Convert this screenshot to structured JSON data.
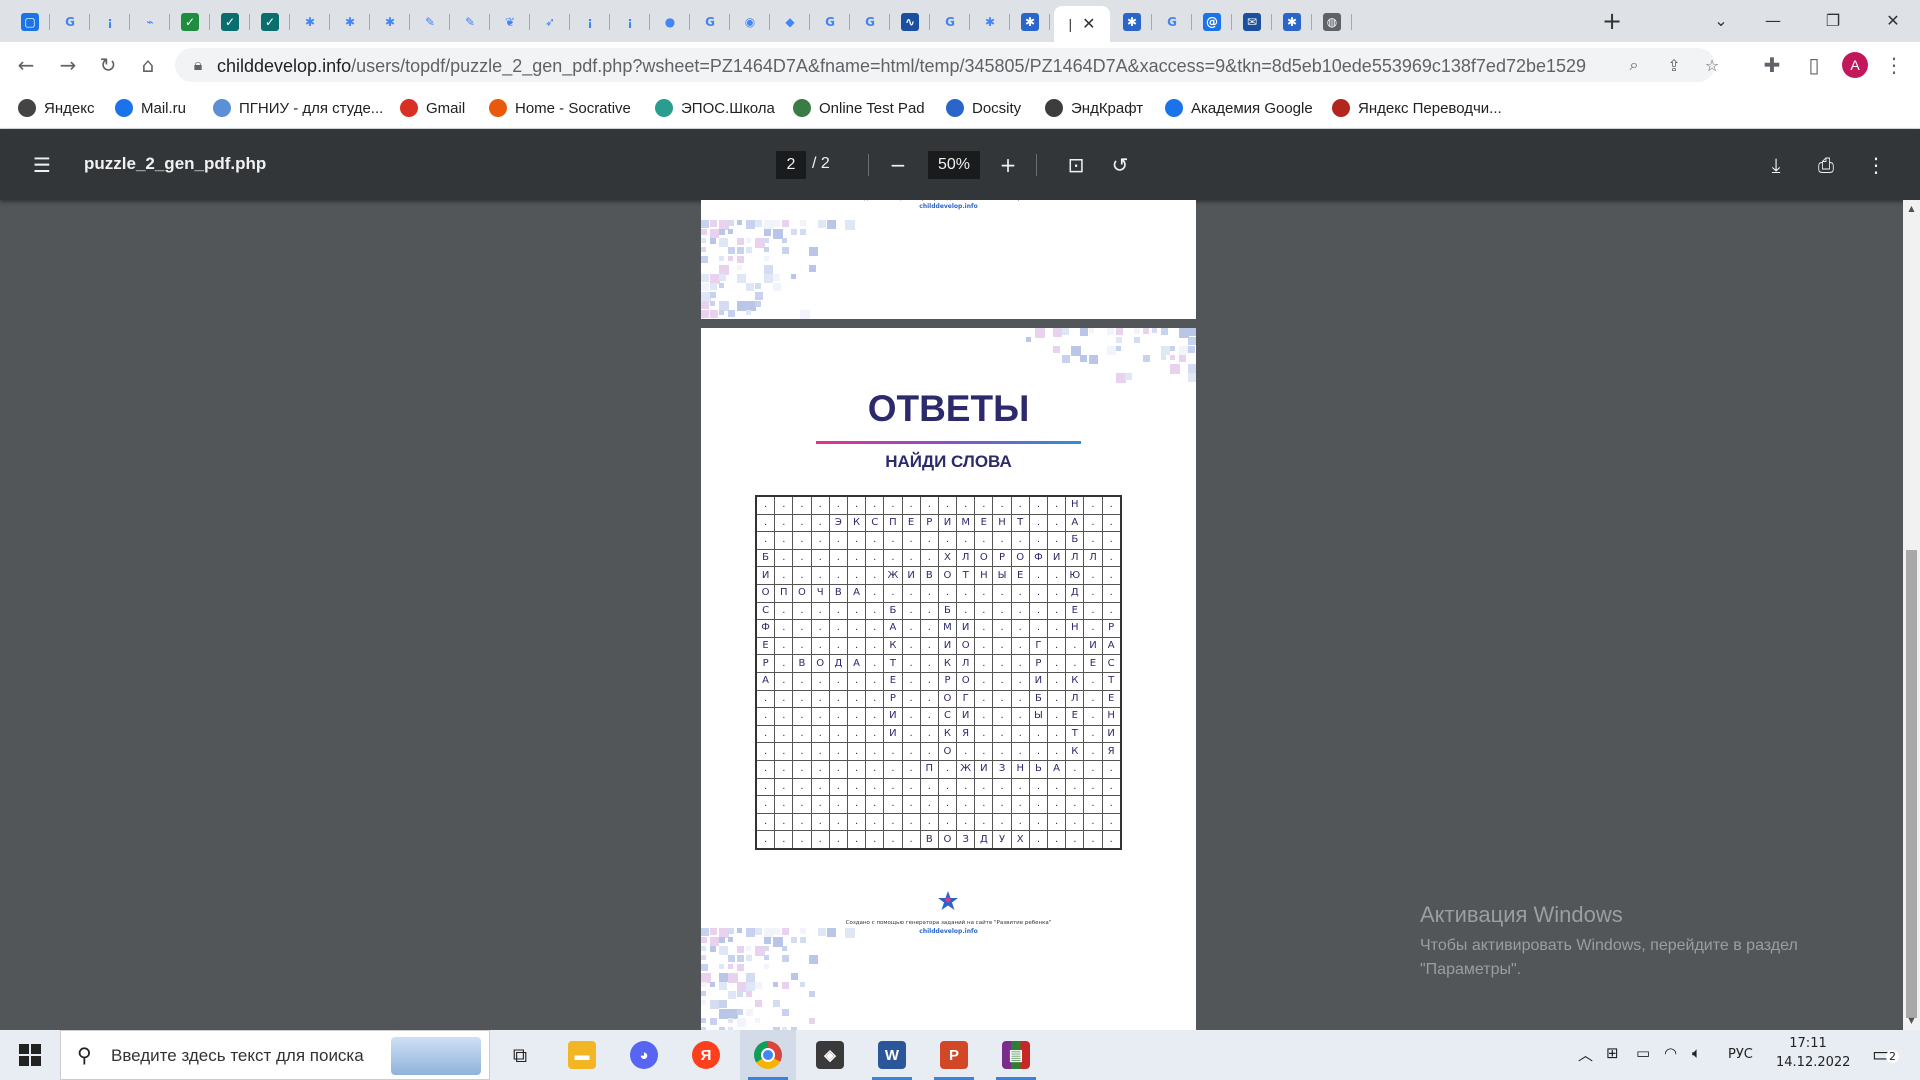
{
  "browser": {
    "tabs": [
      {
        "icon": "chat-icon",
        "color": "#1a73e8",
        "glyph": "▢"
      },
      {
        "icon": "google-icon",
        "color": "#fff",
        "glyph": "G"
      },
      {
        "icon": "yandex-icon",
        "color": "#fff",
        "glyph": "¡"
      },
      {
        "icon": "bird-icon",
        "color": "#fff",
        "glyph": "⌁"
      },
      {
        "icon": "check-green-icon",
        "color": "#1e8e3e",
        "glyph": "✓"
      },
      {
        "icon": "check-teal-icon",
        "color": "#0b6e6e",
        "glyph": "✓"
      },
      {
        "icon": "check-teal-icon",
        "color": "#0b6e6e",
        "glyph": "✓"
      },
      {
        "icon": "puzzle-star-icon",
        "color": "#fff",
        "glyph": "✱"
      },
      {
        "icon": "puzzle-star-icon",
        "color": "#fff",
        "glyph": "✱"
      },
      {
        "icon": "puzzle-star-icon",
        "color": "#fff",
        "glyph": "✱"
      },
      {
        "icon": "paper-icon",
        "color": "#fff",
        "glyph": "✎"
      },
      {
        "icon": "paper-icon",
        "color": "#fff",
        "glyph": "✎"
      },
      {
        "icon": "apple-icon",
        "color": "#fff",
        "glyph": "❦"
      },
      {
        "icon": "sender-icon",
        "color": "#fff",
        "glyph": "➶"
      },
      {
        "icon": "yandex-icon",
        "color": "#fff",
        "glyph": "¡"
      },
      {
        "icon": "yandex-icon",
        "color": "#fff",
        "glyph": "¡"
      },
      {
        "icon": "ladybug-icon",
        "color": "#fff",
        "glyph": "●"
      },
      {
        "icon": "google-icon",
        "color": "#fff",
        "glyph": "G"
      },
      {
        "icon": "compass-icon",
        "color": "#fff",
        "glyph": "◉"
      },
      {
        "icon": "shield-icon",
        "color": "#fff",
        "glyph": "◆"
      },
      {
        "icon": "google-icon",
        "color": "#fff",
        "glyph": "G"
      },
      {
        "icon": "google-icon",
        "color": "#fff",
        "glyph": "G"
      },
      {
        "icon": "chart-icon",
        "color": "#1a4fa0",
        "glyph": "∿"
      },
      {
        "icon": "google-icon",
        "color": "#fff",
        "glyph": "G"
      },
      {
        "icon": "puzzle-star-icon",
        "color": "#fff",
        "glyph": "✱"
      },
      {
        "icon": "puzzle-blue-icon",
        "color": "#2a66c9",
        "glyph": "✱"
      }
    ],
    "active_tab": {
      "label": "|",
      "close": "✕"
    },
    "tabs_after": [
      {
        "icon": "puzzle-blue-icon",
        "color": "#2a66c9",
        "glyph": "✱"
      },
      {
        "icon": "google-icon",
        "color": "#fff",
        "glyph": "G"
      },
      {
        "icon": "mail-at-icon",
        "color": "#1a73e8",
        "glyph": "@"
      },
      {
        "icon": "mail-blue-icon",
        "color": "#1a4fa0",
        "glyph": "✉"
      },
      {
        "icon": "puzzle-blue-icon",
        "color": "#2a66c9",
        "glyph": "✱"
      },
      {
        "icon": "globe-icon",
        "color": "#5f6368",
        "glyph": "◍"
      }
    ],
    "url_host": "childdevelop.info",
    "url_rest": "/users/topdf/puzzle_2_gen_pdf.php?wsheet=PZ1464D7A&fname=html/temp/345805/PZ1464D7A&xaccess=9&tkn=8d5eb10ede553969c138f7ed72be1529",
    "avatar_letter": "A",
    "bookmarks": [
      {
        "label": "Яндекс",
        "color": "#444"
      },
      {
        "label": "Mail.ru",
        "color": "#1a73e8"
      },
      {
        "label": "ПГНИУ - для студе...",
        "color": "#5b8fd6"
      },
      {
        "label": "Gmail",
        "color": "#d93025"
      },
      {
        "label": "Home - Socrative",
        "color": "#e8590c"
      },
      {
        "label": "ЭПОС.Школа",
        "color": "#2a9d8f"
      },
      {
        "label": "Online Test Pad",
        "color": "#3a7d44"
      },
      {
        "label": "Docsity",
        "color": "#2a66c9"
      },
      {
        "label": "ЭндКрафт",
        "color": "#3d3d3d"
      },
      {
        "label": "Академия Google",
        "color": "#1a73e8"
      },
      {
        "label": "Яндекс Переводчи...",
        "color": "#b3261e"
      }
    ]
  },
  "pdf": {
    "filename": "puzzle_2_gen_pdf.php",
    "current_page": "2",
    "total_pages": "/  2",
    "zoom": "50%"
  },
  "sheet": {
    "title": "ОТВЕТЫ",
    "subtitle": "НАЙДИ СЛОВА",
    "footer_small": "Создано с помощью генератора заданий на сайте \"Развитие ребенка\"",
    "footer_link": "childdevelop.info",
    "grid": [
      ". . . . . . . . . . . . . . . . . Н . .",
      ". . . . Э К С П Е Р И М Е Н Т . . А . .",
      ". . . . . . . . . . . . . . . . . Б . .",
      "Б . . . . . . . . . Х Л О Р О Ф И Л Л .",
      "И . . . . . . Ж И В О Т Н Ы Е . . Ю . .",
      "О П О Ч В А . . . . . . . . . . . Д . .",
      "С . . . . . . Б . . Б . . . . . . Е . .",
      "Ф . . . . . . А . . М И . . . . . Н . Р",
      "Е . . . . . . К . . И О . . . Г . . И А",
      "Р . В О Д А . Т . . К Л . . . Р . . Е С",
      "А . . . . . . Е . . Р О . . . И . К . Т",
      ". . . . . . . Р . . О Г . . . Б . Л . Е",
      ". . . . . . . И . . С И . . . Ы . Е . Н",
      ". . . . . . . И . . К Я . . . . . Т . И",
      ". . . . . . . . . . О . . . . . . К . Я",
      ". . . . . . . . . П . Ж И З Н Ь А . . .",
      ". . . . . . . . . . . . . . . . . . . .",
      ". . . . . . . . . . . . . . . . . . . .",
      ". . . . . . . . . . . . . . . . . . . .",
      ". . . . . . . . . В О З Д У Х . . . . ."
    ]
  },
  "windows": {
    "activation_title": "Активация Windows",
    "activation_text": "Чтобы активировать Windows, перейдите в раздел \"Параметры\".",
    "search_placeholder": "Введите здесь текст для поиска",
    "lang": "РУС",
    "time": "17:11",
    "date": "14.12.2022",
    "notifications": "2"
  }
}
